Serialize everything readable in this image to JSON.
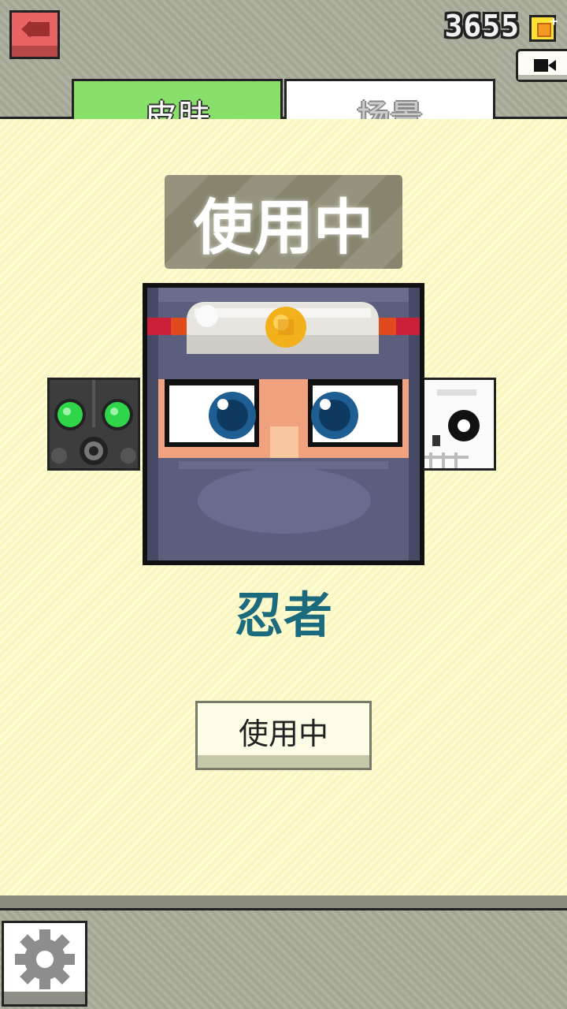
{
  "header": {
    "coin_count": "3655",
    "back_icon": "back-arrow-icon",
    "coin_icon": "coin-icon",
    "video_icon": "video-camera-icon"
  },
  "tabs": [
    {
      "label": "皮肤",
      "selected": true
    },
    {
      "label": "场景",
      "selected": false
    }
  ],
  "skin": {
    "status_banner": "使用中",
    "name": "忍者",
    "action_button": "使用中"
  },
  "footer": {
    "settings_icon": "gear-icon"
  },
  "colors": {
    "tab_selected": "#88e06a",
    "back_button": "#e86464",
    "skin_name": "#1c6a7e",
    "background": "#fdfbc2"
  }
}
